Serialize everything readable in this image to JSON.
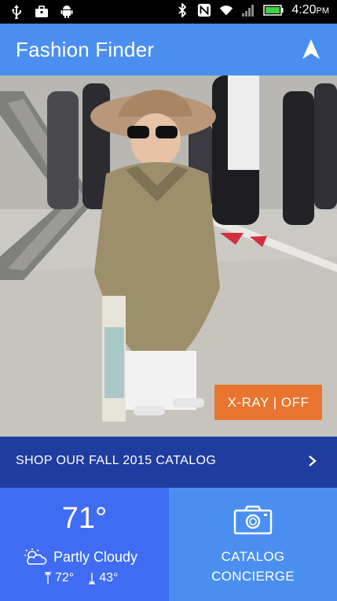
{
  "status_bar": {
    "time": "4:20",
    "ampm": "PM",
    "icons": [
      "usb-icon",
      "briefcase-icon",
      "android-icon",
      "bluetooth-icon",
      "nfc-icon",
      "wifi-icon",
      "signal-icon",
      "battery-icon"
    ]
  },
  "app_bar": {
    "title": "Fashion Finder",
    "nav_icon": "navigation-arrow-icon"
  },
  "hero": {
    "photo_icon": "street-fashion-photo",
    "xray_label": "X-RAY | OFF"
  },
  "catalog_banner": {
    "label": "SHOP OUR FALL 2015 CATALOG",
    "icon": "chevron-right-icon"
  },
  "weather": {
    "temp": "71°",
    "condition": "Partly Cloudy",
    "high": "72°",
    "low": "43°",
    "condition_icon": "partly-cloudy-icon"
  },
  "concierge": {
    "line1": "CATALOG",
    "line2": "CONCIERGE",
    "icon": "camera-icon"
  },
  "colors": {
    "app_bar": "#4a8ff0",
    "xray_button": "#e8742f",
    "catalog_banner": "#1f3da0",
    "weather_tile": "#3f6cf2",
    "concierge_tile": "#4a8ff0"
  }
}
